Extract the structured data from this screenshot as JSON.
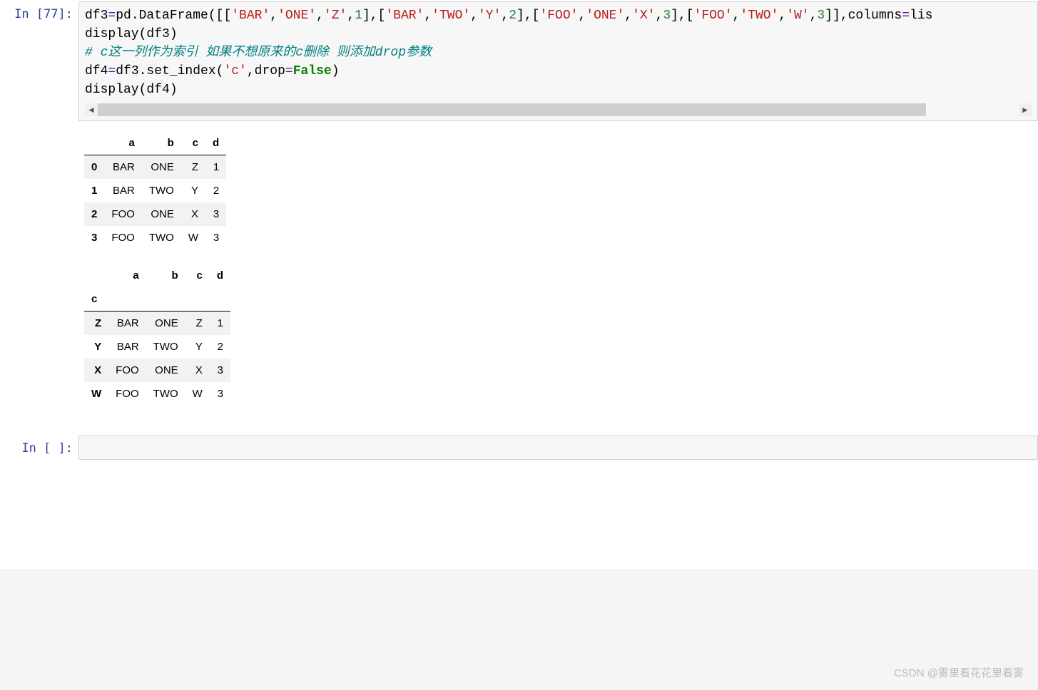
{
  "cell1": {
    "prompt_label": "In  [77]:",
    "code": {
      "line1_a": "df3",
      "line1_b": "pd.DataFrame([[",
      "line1_str1": "'BAR'",
      "line1_str2": "'ONE'",
      "line1_str3": "'Z'",
      "line1_num1": "1",
      "line1_str4": "'BAR'",
      "line1_str5": "'TWO'",
      "line1_str6": "'Y'",
      "line1_num2": "2",
      "line1_str7": "'FOO'",
      "line1_str8": "'ONE'",
      "line1_str9": "'X'",
      "line1_num3": "3",
      "line1_str10": "'FOO'",
      "line1_str11": "'TWO'",
      "line1_str12": "'W'",
      "line1_num4": "3",
      "line1_tail_kw": "columns",
      "line1_tail_rhs": "lis",
      "line2": "display(df3)",
      "line3_comment": "# c这一列作为索引 如果不想原来的c删除 则添加drop参数",
      "line4_a": "df4",
      "line4_b": "df3.set_index(",
      "line4_str": "'c'",
      "line4_c": ",drop",
      "line4_bool": "False",
      "line4_d": ")",
      "line5": "display(df4)"
    }
  },
  "output": {
    "df3": {
      "columns": [
        "a",
        "b",
        "c",
        "d"
      ],
      "index": [
        "0",
        "1",
        "2",
        "3"
      ],
      "rows": [
        [
          "BAR",
          "ONE",
          "Z",
          "1"
        ],
        [
          "BAR",
          "TWO",
          "Y",
          "2"
        ],
        [
          "FOO",
          "ONE",
          "X",
          "3"
        ],
        [
          "FOO",
          "TWO",
          "W",
          "3"
        ]
      ]
    },
    "df4": {
      "index_name": "c",
      "columns": [
        "a",
        "b",
        "c",
        "d"
      ],
      "index": [
        "Z",
        "Y",
        "X",
        "W"
      ],
      "rows": [
        [
          "BAR",
          "ONE",
          "Z",
          "1"
        ],
        [
          "BAR",
          "TWO",
          "Y",
          "2"
        ],
        [
          "FOO",
          "ONE",
          "X",
          "3"
        ],
        [
          "FOO",
          "TWO",
          "W",
          "3"
        ]
      ]
    }
  },
  "cell2": {
    "prompt_label": "In  [ ]:"
  },
  "watermark": "CSDN @雾里看花花里看雾"
}
